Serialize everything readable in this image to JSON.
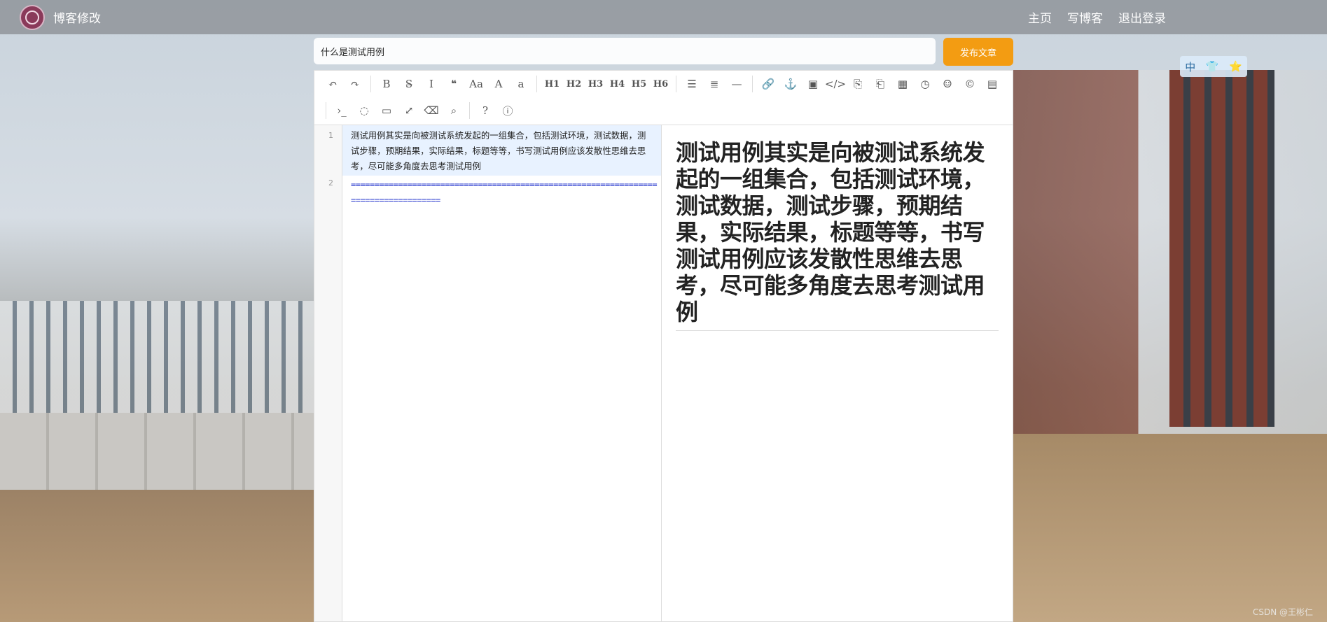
{
  "nav": {
    "brand": "博客修改",
    "links": [
      "主页",
      "写博客",
      "退出登录"
    ]
  },
  "title": {
    "value": "什么是测试用例",
    "publish_label": "发布文章"
  },
  "toolbar": {
    "row1": [
      {
        "name": "undo-icon",
        "glyph": "↶"
      },
      {
        "name": "redo-icon",
        "glyph": "↷"
      },
      {
        "sep": true
      },
      {
        "name": "bold-icon",
        "glyph": "B"
      },
      {
        "name": "strikethrough-icon",
        "glyph": "S̶"
      },
      {
        "name": "italic-icon",
        "glyph": "I"
      },
      {
        "name": "quote-icon",
        "glyph": "❝"
      },
      {
        "name": "uppercase-icon",
        "glyph": "Aa"
      },
      {
        "name": "uppercase-all-icon",
        "glyph": "A"
      },
      {
        "name": "lowercase-icon",
        "glyph": "a"
      },
      {
        "sep": true
      },
      {
        "name": "h1-icon",
        "glyph": "H1",
        "h": true
      },
      {
        "name": "h2-icon",
        "glyph": "H2",
        "h": true
      },
      {
        "name": "h3-icon",
        "glyph": "H3",
        "h": true
      },
      {
        "name": "h4-icon",
        "glyph": "H4",
        "h": true
      },
      {
        "name": "h5-icon",
        "glyph": "H5",
        "h": true
      },
      {
        "name": "h6-icon",
        "glyph": "H6",
        "h": true
      },
      {
        "sep": true
      },
      {
        "name": "unordered-list-icon",
        "glyph": "☰"
      },
      {
        "name": "ordered-list-icon",
        "glyph": "≣"
      },
      {
        "name": "hr-icon",
        "glyph": "—"
      },
      {
        "sep": true
      },
      {
        "name": "link-icon",
        "glyph": "🔗"
      },
      {
        "name": "anchor-icon",
        "glyph": "⚓"
      },
      {
        "name": "image-icon",
        "glyph": "▣"
      },
      {
        "name": "code-icon",
        "glyph": "</>"
      },
      {
        "name": "preformatted-icon",
        "glyph": "⎘"
      },
      {
        "name": "code-block-icon",
        "glyph": "⎗"
      },
      {
        "name": "table-icon",
        "glyph": "▦"
      },
      {
        "name": "datetime-icon",
        "glyph": "◷"
      },
      {
        "name": "emoji-icon",
        "glyph": "☺"
      },
      {
        "name": "html-entities-icon",
        "glyph": "©"
      },
      {
        "name": "pagebreak-icon",
        "glyph": "▤"
      }
    ],
    "row2": [
      {
        "sep": true
      },
      {
        "name": "goto-line-icon",
        "glyph": "›_"
      },
      {
        "name": "hide-preview-icon",
        "glyph": "◌"
      },
      {
        "name": "watch-icon",
        "glyph": "▭"
      },
      {
        "name": "fullscreen-icon",
        "glyph": "⤢"
      },
      {
        "name": "clear-icon",
        "glyph": "⌫"
      },
      {
        "name": "search-icon",
        "glyph": "⌕"
      },
      {
        "sep": true
      },
      {
        "name": "help-icon",
        "glyph": "?"
      },
      {
        "name": "info-icon",
        "glyph": "ⓘ"
      }
    ]
  },
  "editor": {
    "line_numbers": [
      "1",
      "2"
    ],
    "line1": "测试用例其实是向被测试系统发起的一组集合，包括测试环境，测试数据，测试步骤，预期结果，实际结果，标题等等，书写测试用例应该发散性思维去思考，尽可能多角度去思考测试用例",
    "line2": "===================================================================================="
  },
  "preview": {
    "heading": "测试用例其实是向被测试系统发起的一组集合，包括测试环境，测试数据，测试步骤，预期结果，实际结果，标题等等，书写测试用例应该发散性思维去思考，尽可能多角度去思考测试用例"
  },
  "widget": [
    "中",
    "👕",
    "⭐"
  ],
  "watermark": "CSDN @王彬仁"
}
